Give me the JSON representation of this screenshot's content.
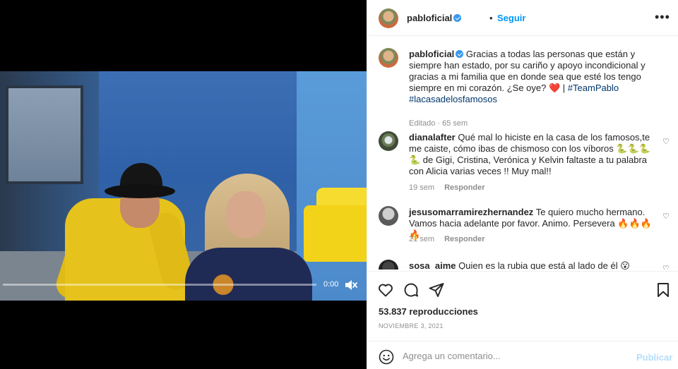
{
  "video": {
    "time": "0:00",
    "progress": 0.0,
    "muted": true,
    "mute_icon": "speaker-muted-icon"
  },
  "header": {
    "username": "pabloficial",
    "dot": "•",
    "follow_label": "Seguir",
    "more_icon": "more-options-icon"
  },
  "caption": {
    "username": "pabloficial",
    "text": "Gracias a todas las personas que están y siempre han estado, por su cariño y apoyo incondicional y gracias a mi familia que en donde sea que esté los tengo siempre en mi corazón. ¿Se oye?",
    "heart": "❤️",
    "separator": " | ",
    "hashtag1": "#TeamPablo",
    "hashtag2": "#lacasadelosfamosos",
    "meta": "Editado · 65 sem"
  },
  "comments": [
    {
      "username": "dianalafter",
      "text": "Qué mal lo hiciste en la casa de los famosos,te me caiste, cómo ibas de chismoso con los víboros 🐍🐍🐍🐍 de Gigi, Cristina, Verónica y Kelvin faltaste a tu palabra con Alicia varias veces !! Muy mal!!",
      "time": "19 sem",
      "reply": "Responder"
    },
    {
      "username": "jesusomarramirezhernandez",
      "text": "Te quiero mucho hermano. Vamos hacia adelante por favor. Animo. Persevera 🔥🔥🔥🔥",
      "time": "21 sem",
      "reply": "Responder"
    },
    {
      "username": "sosa_aime",
      "text": "Quien es la rubia que está al lado de él 😮"
    }
  ],
  "actions": {
    "like_icon": "heart-icon",
    "comment_icon": "comment-icon",
    "share_icon": "share-icon",
    "save_icon": "bookmark-icon"
  },
  "stats": {
    "views": "53.837 reproducciones",
    "date": "NOVIEMBRE 3, 2021"
  },
  "add_comment": {
    "placeholder": "Agrega un comentario...",
    "publish_label": "Publicar",
    "emoji_icon": "emoji-icon"
  },
  "colors": {
    "link_blue": "#0095f6",
    "verified_blue": "#3897f0",
    "hashtag": "#00376b",
    "publish_disabled": "#b2dffc"
  }
}
